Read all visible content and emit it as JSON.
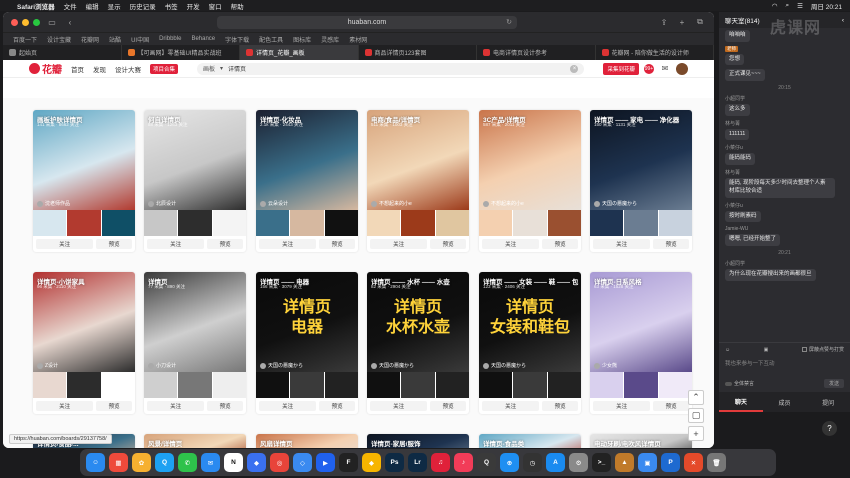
{
  "menubar": {
    "app_name": "Safari浏览器",
    "items": [
      "文件",
      "编辑",
      "显示",
      "历史记录",
      "书签",
      "开发",
      "窗口",
      "帮助"
    ],
    "clock": "周日 20:21"
  },
  "browser": {
    "url": "huaban.com",
    "bookmarks": [
      "百度一下",
      "设计宝藏",
      "花瓣网",
      "站酷",
      "UI中国",
      "Dribbble",
      "Behance",
      "字体下载",
      "配色工具",
      "图标库",
      "灵感库",
      "素材网"
    ],
    "tabs": [
      {
        "label": "起始页"
      },
      {
        "label": "【可画网】零基础UI精品实战班"
      },
      {
        "label": "详情页_花瓣_画板",
        "active": true
      },
      {
        "label": "商品详情页123套图"
      },
      {
        "label": "电商详情页设计参考"
      },
      {
        "label": "花瓣网 - 陪你做生活的设计师"
      }
    ],
    "status_link": "https://huaban.com/boards/29137758/"
  },
  "site": {
    "logo": "花瓣",
    "nav": [
      "首页",
      "发现",
      "设计大赛"
    ],
    "nav_badge": "项目合集",
    "search_prefix": "画板",
    "search_value": "详情页",
    "header_button": "采集到花瓣",
    "notif_count": "99+"
  },
  "cards_row1": [
    {
      "title": "画板护肤详情页",
      "meta": "141 采集 · 8662 关注",
      "user": "沈老师作品",
      "follow": "关注",
      "preview": "预览"
    },
    {
      "title": "何自详情页",
      "meta": "88 采集 · 1263 关注",
      "user": "北辰设计",
      "follow": "关注",
      "preview": "预览"
    },
    {
      "title": "详情页-化妆品",
      "meta": "2.1k 采集 · 2443 关注",
      "user": "云朵设计",
      "follow": "关注",
      "preview": "预览"
    },
    {
      "title": "电商/食品/详情页",
      "meta": "511 采集 · 1003 关注",
      "user": "不想起来的小e",
      "follow": "关注",
      "preview": "预览"
    },
    {
      "title": "3C产品/详情页",
      "meta": "587 采集 · 2011 关注",
      "user": "不想起来的小e",
      "follow": "关注",
      "preview": "预览"
    },
    {
      "title": "详情页 —— 家电 —— 净化器",
      "meta": "150 采集 · 1131 关注",
      "user": "天国の悪魔から",
      "follow": "关注",
      "preview": "预览"
    }
  ],
  "cards_row2": [
    {
      "title": "详情页-小饼家具",
      "meta": "96 采集 · 2110 关注",
      "user": "Z设计",
      "follow": "关注",
      "preview": "预览"
    },
    {
      "title": "详情页",
      "meta": "77 采集 · 890 关注",
      "user": "小刀设计",
      "follow": "关注",
      "preview": "预览"
    },
    {
      "title": "详情页 —— 电器",
      "meta": "156 采集 · 3079 关注",
      "big": "详情页\n电器",
      "user": "天国の悪魔から",
      "follow": "关注",
      "preview": "预览"
    },
    {
      "title": "详情页 —— 水杯 —— 水壶",
      "meta": "82 采集 · 2904 关注",
      "big": "详情页\n水杯水壶",
      "user": "天国の悪魔から",
      "follow": "关注",
      "preview": "预览"
    },
    {
      "title": "详情页 —— 女装 —— 鞋 —— 包",
      "meta": "123 采集 · 2406 关注",
      "big": "详情页\n女装和鞋包",
      "user": "天国の悪魔から",
      "follow": "关注",
      "preview": "预览"
    },
    {
      "title": "详情页-日系风格",
      "meta": "63 采集 · 1528 关注",
      "user": "少女熊",
      "follow": "关注",
      "preview": "预览"
    }
  ],
  "cards_row3": [
    {
      "title": "详情页/食品/..."
    },
    {
      "title": "风景/详情页"
    },
    {
      "title": "风扇详情页"
    },
    {
      "title": "详情页-家居/服饰"
    },
    {
      "title": "详情页-食品类"
    },
    {
      "title": "电动牙刷/电吹风详情页"
    }
  ],
  "chat": {
    "header": "聊天室(814)",
    "watermark": "虎课网",
    "messages": [
      {
        "type": "text",
        "text": "咱咱咱"
      },
      {
        "type": "user",
        "who": "老师",
        "tag": "老师",
        "text": "您想"
      },
      {
        "type": "text",
        "text": "正式课见~~~"
      },
      {
        "type": "time",
        "text": "20:15"
      },
      {
        "type": "user",
        "who": "小超同学",
        "text": "这么多"
      },
      {
        "type": "user",
        "who": "林与菁",
        "text": "111111"
      },
      {
        "type": "user",
        "who": "小菜仔u",
        "text": "能码能码"
      },
      {
        "type": "user",
        "who": "林与菁",
        "text": "能码, 现阶段每天多少时间去整理个人素材库比较合适"
      },
      {
        "type": "user",
        "who": "小菜仔u",
        "text": "按时刷素码"
      },
      {
        "type": "user",
        "who": "Jamie-WU",
        "text": "嗯嗯, 已经开始整了"
      },
      {
        "type": "time",
        "text": "20:21"
      },
      {
        "type": "user",
        "who": "小超同学",
        "text": "为什么现在花瓣搜出来的画都很旦"
      }
    ],
    "input_toggle": "屏蔽点赞与打赏",
    "input_placeholder": "我也来参与一下互动",
    "input_check": "全体禁言",
    "send": "发送",
    "tabs": [
      "聊天",
      "成员",
      "提问"
    ]
  },
  "dock": {
    "apps": [
      {
        "name": "finder-icon",
        "label": "☺",
        "color": "#2a8af0"
      },
      {
        "name": "launchpad-icon",
        "label": "▦",
        "color": "#ee4a3b"
      },
      {
        "name": "photos-icon",
        "label": "✿",
        "color": "#f6b030"
      },
      {
        "name": "qq-icon",
        "label": "Q",
        "color": "#1da1f2"
      },
      {
        "name": "wechat-icon",
        "label": "✆",
        "color": "#2ec24b"
      },
      {
        "name": "mail-icon",
        "label": "✉",
        "color": "#2a8af0"
      },
      {
        "name": "notion-icon",
        "label": "N",
        "color": "#ffffff"
      },
      {
        "name": "feishu-icon",
        "label": "◆",
        "color": "#3a70f0"
      },
      {
        "name": "chrome-icon",
        "label": "◎",
        "color": "#e8443a"
      },
      {
        "name": "dingtalk-icon",
        "label": "◇",
        "color": "#3a8af0"
      },
      {
        "name": "tencent-meeting-icon",
        "label": "▶",
        "color": "#2061ee"
      },
      {
        "name": "figma-icon",
        "label": "F",
        "color": "#222222"
      },
      {
        "name": "sketch-icon",
        "label": "◆",
        "color": "#f7b500"
      },
      {
        "name": "photoshop-icon",
        "label": "Ps",
        "color": "#0e2a44"
      },
      {
        "name": "lightroom-icon",
        "label": "Lr",
        "color": "#0e2a44"
      },
      {
        "name": "netease-music-icon",
        "label": "♫",
        "color": "#e0213a"
      },
      {
        "name": "music-icon",
        "label": "♪",
        "color": "#f23c58"
      },
      {
        "name": "quicktime-icon",
        "label": "Q",
        "color": "#3a3a3a"
      },
      {
        "name": "safari-icon",
        "label": "⊕",
        "color": "#1e8ff2"
      },
      {
        "name": "clock-icon",
        "label": "◷",
        "color": "#333333"
      },
      {
        "name": "appstore-icon",
        "label": "A",
        "color": "#1a8bf0"
      },
      {
        "name": "settings-icon",
        "label": "⚙",
        "color": "#8a8a8a"
      },
      {
        "name": "terminal-icon",
        "label": ">_",
        "color": "#222222"
      },
      {
        "name": "cursor-icon",
        "label": "▲",
        "color": "#c07a2a"
      },
      {
        "name": "preview-icon",
        "label": "▣",
        "color": "#3a8af0"
      },
      {
        "name": "ppt-icon",
        "label": "P",
        "color": "#1e6ad0"
      },
      {
        "name": "xmind-icon",
        "label": "✕",
        "color": "#e44a2a"
      },
      {
        "name": "trash-icon",
        "label": "🗑",
        "color": "#777777"
      }
    ]
  }
}
